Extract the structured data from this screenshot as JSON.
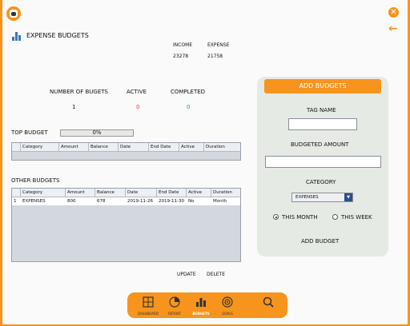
{
  "header": {
    "title": "EXPENSE BUDGETS",
    "close_icon": "close-icon",
    "back_icon": "back-arrow-icon"
  },
  "summary": {
    "income_label": "INCOME",
    "income_value": "23278",
    "expense_label": "EXPENSE",
    "expense_value": "21758"
  },
  "stats": {
    "number_label": "NUMBER OF BUGETS",
    "number_value": "1",
    "active_label": "ACTIVE",
    "active_value": "0",
    "completed_label": "COMPLETED",
    "completed_value": "0"
  },
  "top_budget": {
    "label": "TOP BUDGET",
    "progress_text": "0%",
    "progress": 0,
    "columns": [
      "Category",
      "Amount",
      "Balance",
      "Date",
      "End Date",
      "Active",
      "Duration"
    ]
  },
  "other_budgets": {
    "label": "OTHER BUDGETS",
    "columns": [
      "Category",
      "Amount",
      "Balance",
      "Date",
      "End Date",
      "Active",
      "Duration"
    ],
    "rows": [
      {
        "num": "1",
        "category": "EXPENSES",
        "amount": "800",
        "balance": "678",
        "date": "2019-11-26",
        "end_date": "2019-11-30",
        "active": "No",
        "duration": "Month"
      }
    ]
  },
  "actions": {
    "update": "UPDATE",
    "delete": "DELETE"
  },
  "add_panel": {
    "button": "ADD BUDGETS",
    "tag_label": "TAG NAME",
    "tag_value": "",
    "amount_label": "BUDGETED AMOUNT",
    "amount_value": "",
    "category_label": "CATEGORY",
    "category_selected": "EXPENSES",
    "radio_month": "THIS MONTH",
    "radio_week": "THIS WEEK",
    "radio_selected": "THIS MONTH",
    "add_budget": "ADD BUDGET"
  },
  "nav": {
    "items": [
      {
        "label": "DASHBOARD",
        "icon": "dashboard-icon"
      },
      {
        "label": "REPORT",
        "icon": "report-icon"
      },
      {
        "label": "BUDGETS",
        "icon": "budgets-icon"
      },
      {
        "label": "GOALS",
        "icon": "goals-icon"
      },
      {
        "label": "",
        "icon": "search-icon"
      }
    ],
    "active": "BUDGETS"
  },
  "colors": {
    "accent": "#f7941d",
    "active_red": "#e53935",
    "completed_green": "#43a047",
    "panel": "#e6eae4"
  }
}
